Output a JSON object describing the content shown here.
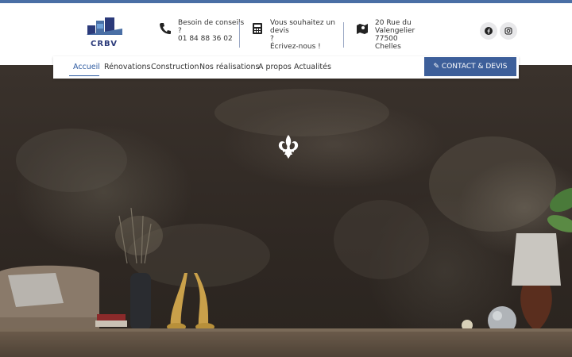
{
  "header": {
    "logo_text": "CRBV",
    "contact1": {
      "line1": "Besoin de conseils ?",
      "line2": "01 84 88 36 02"
    },
    "contact2": {
      "line1": "Vous souhaitez un devis",
      "line2": "?",
      "line3": "Écrivez-nous !"
    },
    "contact3": {
      "line1": "20 Rue du",
      "line2": "Valengelier",
      "line3": "77500 Chelles"
    }
  },
  "nav": {
    "items": [
      "Accueil",
      "Rénovations",
      "Construction",
      "Nos réalisations",
      "A propos",
      "Actualités"
    ],
    "active": "Accueil",
    "cta": "CONTACT & DEVIS"
  },
  "colors": {
    "accent": "#3d5f9a",
    "topbar": "#4a6fa5"
  },
  "icons": [
    "phone-icon",
    "calculator-icon",
    "map-icon",
    "facebook-icon",
    "instagram-icon",
    "pencil-icon",
    "fleur-de-lis-icon"
  ]
}
